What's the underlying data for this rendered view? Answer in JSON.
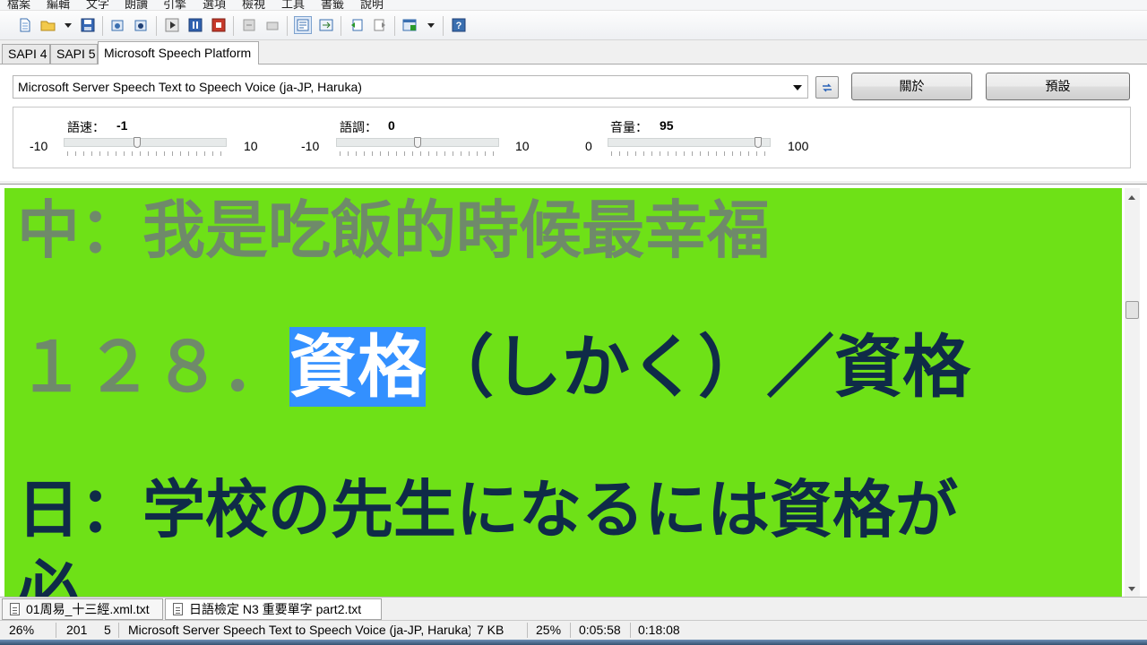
{
  "menu": [
    "檔案",
    "編輯",
    "文字",
    "朗讀",
    "引擎",
    "選項",
    "檢視",
    "工具",
    "書籤",
    "說明"
  ],
  "toolbar": {
    "icons": [
      "new-file-icon",
      "open-folder-icon",
      "save-icon",
      "export-wav-icon",
      "export-mp3-icon",
      "play-icon",
      "pause-icon",
      "stop-icon",
      "prev-icon",
      "next-icon",
      "word-wrap-icon",
      "sync-icon",
      "prev-doc-icon",
      "next-doc-icon",
      "window-icon",
      "help-icon"
    ],
    "help_label": "?"
  },
  "tabs": [
    "SAPI 4",
    "SAPI 5",
    "Microsoft Speech Platform"
  ],
  "voice": {
    "selected": "Microsoft Server Speech Text to Speech Voice (ja-JP, Haruka)"
  },
  "buttons": {
    "about": "關於",
    "defaults": "預設"
  },
  "sliders": {
    "rate": {
      "label": "語速：",
      "value": "-1",
      "min": "-10",
      "max": "10",
      "fraction": 0.45
    },
    "pitch": {
      "label": "語調：",
      "value": "0",
      "min": "-10",
      "max": "10",
      "fraction": 0.5
    },
    "volume": {
      "label": "音量：",
      "value": "95",
      "min": "0",
      "max": "100",
      "fraction": 0.95
    }
  },
  "text": {
    "line1": "中：我是吃飯的時候最幸福",
    "line2_prefix": "１２８．",
    "line2_highlight": "資格",
    "line2_rest": "（しかく）／資格",
    "line3": "日：学校の先生になるには資格が",
    "line4": "必"
  },
  "doc_tabs": [
    "01周易_十三經.xml.txt",
    "日語檢定 N3 重要單字 part2.txt"
  ],
  "status": {
    "zoom": "26%",
    "line": "201",
    "col": "5",
    "voice": "Microsoft Server Speech Text to Speech Voice (ja-JP, Haruka)",
    "size": "7 KB",
    "progress": "25%",
    "elapsed": "0:05:58",
    "total": "0:18:08"
  },
  "colors": {
    "text_bg": "#6ee117",
    "read_text": "#6f8a6a",
    "unread_text": "#0f2b48",
    "highlight": "#3390ff"
  }
}
